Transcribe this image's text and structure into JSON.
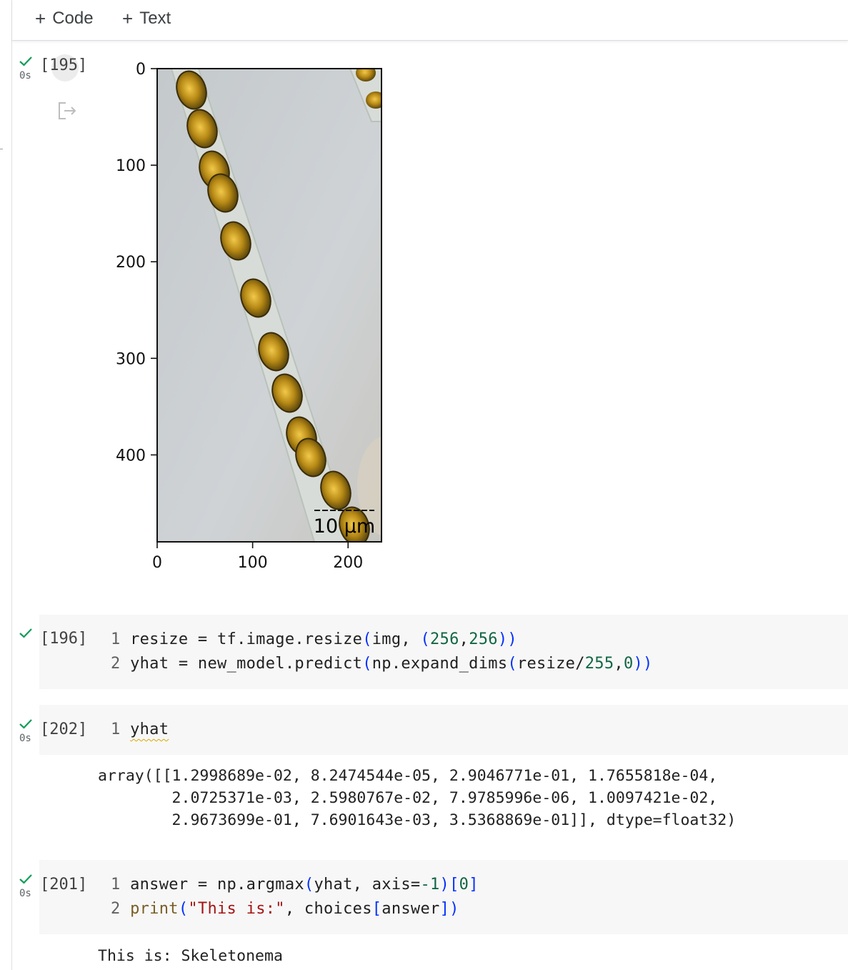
{
  "toolbar": {
    "add_code_label": "Code",
    "add_text_label": "Text"
  },
  "cells": [
    {
      "exec_count": "[195]",
      "exec_time": "0s",
      "chart_data": {
        "type": "image",
        "x_ticks": [
          "0",
          "100",
          "200"
        ],
        "y_ticks": [
          "0",
          "100",
          "200",
          "300",
          "400"
        ],
        "xlim": [
          0,
          235
        ],
        "ylim": [
          490,
          0
        ],
        "scale_bar_label": "10 µm"
      }
    },
    {
      "exec_count": "[196]",
      "lines": [
        {
          "n": "1",
          "text": "resize = tf.image.resize(img, (256,256))"
        },
        {
          "n": "2",
          "text": "yhat = new_model.predict(np.expand_dims(resize/255,0))"
        }
      ]
    },
    {
      "exec_count": "[202]",
      "exec_time": "0s",
      "lines": [
        {
          "n": "1",
          "text": "yhat"
        }
      ],
      "output": [
        "array([[1.2998689e-02, 8.2474544e-05, 2.9046771e-01, 1.7655818e-04,",
        "        2.0725371e-03, 2.5980767e-02, 7.9785996e-06, 1.0097421e-02,",
        "        2.9673699e-01, 7.6901643e-03, 3.5368869e-01]], dtype=float32)"
      ]
    },
    {
      "exec_count": "[201]",
      "exec_time": "0s",
      "lines": [
        {
          "n": "1",
          "text": "answer = np.argmax(yhat, axis=-1)[0]"
        },
        {
          "n": "2",
          "text": "print(\"This is:\", choices[answer])"
        }
      ],
      "output": [
        "This is: Skeletonema"
      ]
    }
  ],
  "colors": {
    "check_green": "#0f9d58",
    "cell_bg": "#f7f7f7",
    "number": "#116644",
    "string": "#a31515",
    "bracket": "#0431fa"
  }
}
